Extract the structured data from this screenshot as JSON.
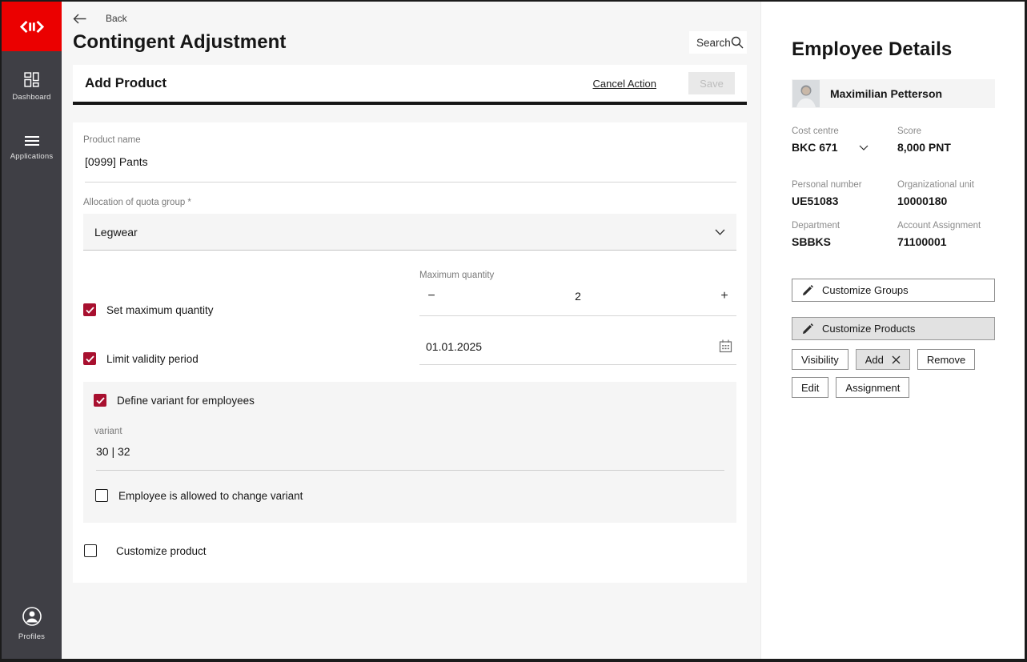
{
  "colors": {
    "brand_red": "#EB0000",
    "checkbox_red": "#A8102F",
    "sidebar_bg": "#3F3F45"
  },
  "sidebar": {
    "items": [
      {
        "label": "Dashboard"
      },
      {
        "label": "Applications"
      }
    ],
    "bottom": {
      "label": "Profiles"
    }
  },
  "header": {
    "back_label": "Back",
    "title": "Contingent Adjustment",
    "search_label": "Search"
  },
  "form": {
    "section_title": "Add Product",
    "cancel_label": "Cancel Action",
    "save_label": "Save",
    "product_name": {
      "label": "Product name",
      "value": "[0999] Pants"
    },
    "quota_group": {
      "label": "Allocation of quota group *",
      "value": "Legwear"
    },
    "max_quantity": {
      "checkbox_label": "Set maximum quantity",
      "checked": true,
      "field_label": "Maximum quantity",
      "minus": "−",
      "value": "2",
      "plus": "+"
    },
    "validity": {
      "checkbox_label": "Limit validity period",
      "checked": true,
      "value": "01.01.2025"
    },
    "variant_section": {
      "checkbox_label": "Define variant for employees",
      "checked": true,
      "variant_label": "variant",
      "variant_value": "30 | 32",
      "allow_change_label": "Employee is allowed to change variant",
      "allow_change_checked": false
    },
    "customize_product": {
      "label": "Customize product",
      "checked": false
    }
  },
  "employee": {
    "title": "Employee Details",
    "name": "Maximilian Petterson",
    "fields": [
      {
        "label": "Cost centre",
        "value": "BKC 671",
        "dropdown": true
      },
      {
        "label": "Score",
        "value": "8,000 PNT"
      },
      {
        "label": "Personal number",
        "value": "UE51083"
      },
      {
        "label": "Organizational unit",
        "value": "10000180"
      },
      {
        "label": "Department",
        "value": "SBBKS"
      },
      {
        "label": "Account Assignment",
        "value": "71100001"
      }
    ],
    "actions": {
      "customize_groups": "Customize Groups",
      "customize_products": "Customize Products",
      "visibility": "Visibility",
      "add": "Add",
      "remove": "Remove",
      "edit": "Edit",
      "assignment": "Assignment"
    }
  }
}
